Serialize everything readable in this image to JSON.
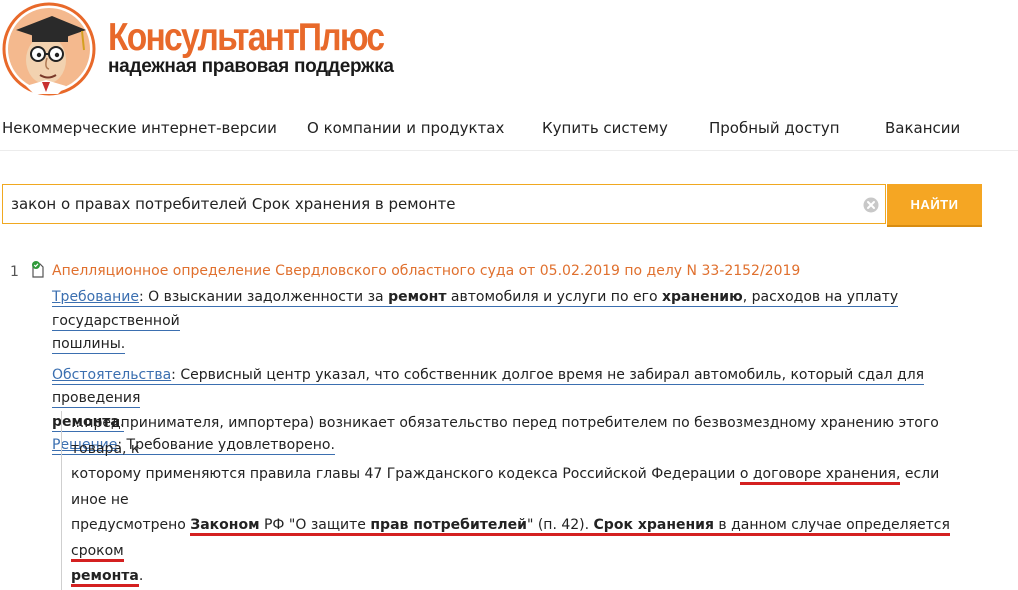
{
  "brand": {
    "name": "КонсультантПлюс",
    "tagline": "надежная правовая поддержка",
    "accent_color": "#e8692a"
  },
  "nav": {
    "items": [
      "Некоммерческие интернет-версии",
      "О компании и продуктах",
      "Купить систему",
      "Пробный доступ",
      "Вакансии"
    ]
  },
  "search": {
    "value": "закон о правах потребителей Срок хранения в ремонте",
    "button_label": "НАЙТИ",
    "clear_icon": "close-circle-icon"
  },
  "result": {
    "number": "1",
    "icon": "document-check-icon",
    "title": "Апелляционное определение Свердловского областного суда от 05.02.2019 по делу N 33-2152/2019",
    "requirement_label": "Требование",
    "requirement": {
      "t1": "О взыскании задолженности за",
      "b1": "ремонт",
      "t2": "автомобиля и услуги по его",
      "b2": "хранению",
      "t3": ", расходов на уплату государственной",
      "t4": "пошлины."
    },
    "circumstances_label": "Обстоятельства",
    "circumstances": {
      "t1": "Сервисный центр указал, что собственник долгое время не забирал автомобиль, который сдал для проведения",
      "b1": "ремонта",
      "t2": "."
    },
    "decision_label": "Решение",
    "decision": "Требование удовлетворено.",
    "snippet": {
      "t1": "...предпринимателя, импортера) возникает обязательство перед потребителем по безвозмездному хранению этого товара, к",
      "t2": "которому применяются правила главы 47 Гражданского кодекса Российской Федерации",
      "t3": "о договоре хранения,",
      "t4": "если иное не",
      "t5": "предусмотрено",
      "b1": "Законом",
      "t6": "РФ \"О защите",
      "b2": "прав потребителей",
      "t7": "\" (п. 42).",
      "b3": "Срок хранения",
      "t8": "в данном случае определяется сроком",
      "b4": "ремонта",
      "t9": "."
    }
  }
}
